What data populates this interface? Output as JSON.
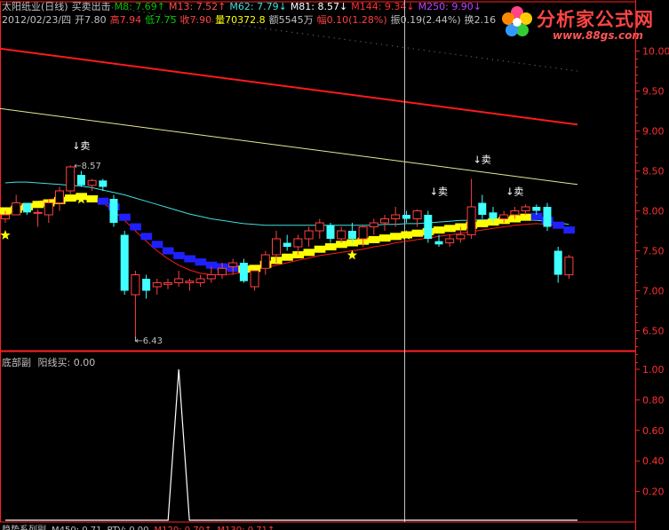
{
  "header": {
    "row1": [
      {
        "text": "太阳纸业(日线)",
        "color": "#c0c0c0"
      },
      {
        "text": "买卖出击",
        "color": "#c0c0c0"
      },
      {
        "text": "M8: 7.69↑",
        "color": "#00c000"
      },
      {
        "text": "M13: 7.52↑",
        "color": "#ff5050"
      },
      {
        "text": "M62: 7.79↓",
        "color": "#40e0e0"
      },
      {
        "text": "M81: 8.57↓",
        "color": "#ffffff"
      },
      {
        "text": "M144: 9.34↓",
        "color": "#ff3030"
      },
      {
        "text": "M250: 9.90↓",
        "color": "#c040ff"
      }
    ],
    "row2": [
      {
        "text": "2012/02/23/四",
        "color": "#c0c0c0"
      },
      {
        "text": "开7.80",
        "color": "#c0c0c0"
      },
      {
        "text": "高7.94",
        "color": "#ff4040"
      },
      {
        "text": "低7.75",
        "color": "#00d000"
      },
      {
        "text": "收7.90",
        "color": "#ff4040"
      },
      {
        "text": "量70372.8",
        "color": "#ffff00"
      },
      {
        "text": "额5545万",
        "color": "#c0c0c0"
      },
      {
        "text": "幅0.10(1.28%)",
        "color": "#ff4040"
      },
      {
        "text": "振0.19(2.44%)",
        "color": "#c0c0c0"
      },
      {
        "text": "换2.16",
        "color": "#c0c0c0"
      }
    ]
  },
  "watermark": {
    "main": "分析家公式网",
    "url": "www.88gs.com"
  },
  "colors": {
    "up": "#ff4040",
    "down": "#40ffff",
    "axis": "#ff2020",
    "ma_red": "#ff1a1a",
    "ma_yellow": "#e8e890",
    "ma_cyan": "#40e0e0",
    "band_yellow": "#ffff00",
    "band_blue": "#2020ff"
  },
  "price_axis": {
    "ticks": [
      "10.00",
      "9.50",
      "9.00",
      "8.50",
      "8.00",
      "7.50",
      "7.00",
      "6.50"
    ],
    "min": 6.25,
    "max": 10.25
  },
  "annotations": {
    "high_label": "8.57",
    "low_label": "6.43",
    "sell_label": "↓卖"
  },
  "sub_panel": {
    "title": "底部副",
    "indicator": "阳线买: 0.00",
    "ticks": [
      "1.00",
      "0.80",
      "0.60",
      "0.40",
      "0.20"
    ]
  },
  "footer": [
    {
      "text": "趋势系列副",
      "color": "#c0c0c0"
    },
    {
      "text": "M450: 0.71",
      "color": "#c0c0c0"
    },
    {
      "text": "PTV: 0.00",
      "color": "#c0c0c0"
    },
    {
      "text": "M120: 0.70↑",
      "color": "#ff4040"
    },
    {
      "text": "M130: 0.71↑",
      "color": "#ff4040"
    }
  ],
  "chart_data": {
    "type": "candlestick",
    "title": "太阳纸业(日线)",
    "ylim": [
      6.25,
      10.25
    ],
    "candles": [
      {
        "o": 7.9,
        "h": 8.0,
        "l": 7.85,
        "c": 7.95
      },
      {
        "o": 7.95,
        "h": 8.2,
        "l": 7.95,
        "c": 8.1
      },
      {
        "o": 8.1,
        "h": 8.1,
        "l": 7.95,
        "c": 7.98
      },
      {
        "o": 7.98,
        "h": 8.02,
        "l": 7.8,
        "c": 7.98
      },
      {
        "o": 7.95,
        "h": 8.15,
        "l": 7.85,
        "c": 8.1
      },
      {
        "o": 8.1,
        "h": 8.3,
        "l": 8.0,
        "c": 8.25
      },
      {
        "o": 8.25,
        "h": 8.57,
        "l": 8.2,
        "c": 8.55
      },
      {
        "o": 8.45,
        "h": 8.5,
        "l": 8.3,
        "c": 8.32
      },
      {
        "o": 8.32,
        "h": 8.4,
        "l": 8.25,
        "c": 8.38
      },
      {
        "o": 8.38,
        "h": 8.4,
        "l": 8.25,
        "c": 8.3
      },
      {
        "o": 8.15,
        "h": 8.2,
        "l": 7.8,
        "c": 7.85
      },
      {
        "o": 7.7,
        "h": 7.75,
        "l": 6.95,
        "c": 7.0
      },
      {
        "o": 6.95,
        "h": 7.25,
        "l": 6.43,
        "c": 7.2
      },
      {
        "o": 7.15,
        "h": 7.2,
        "l": 6.9,
        "c": 7.0
      },
      {
        "o": 7.05,
        "h": 7.15,
        "l": 6.95,
        "c": 7.1
      },
      {
        "o": 7.08,
        "h": 7.15,
        "l": 7.02,
        "c": 7.1
      },
      {
        "o": 7.1,
        "h": 7.25,
        "l": 7.05,
        "c": 7.15
      },
      {
        "o": 7.1,
        "h": 7.15,
        "l": 7.0,
        "c": 7.12
      },
      {
        "o": 7.1,
        "h": 7.2,
        "l": 7.05,
        "c": 7.15
      },
      {
        "o": 7.15,
        "h": 7.3,
        "l": 7.1,
        "c": 7.2
      },
      {
        "o": 7.2,
        "h": 7.35,
        "l": 7.15,
        "c": 7.28
      },
      {
        "o": 7.3,
        "h": 7.4,
        "l": 7.2,
        "c": 7.35
      },
      {
        "o": 7.35,
        "h": 7.4,
        "l": 7.1,
        "c": 7.12
      },
      {
        "o": 7.05,
        "h": 7.25,
        "l": 7.0,
        "c": 7.25
      },
      {
        "o": 7.28,
        "h": 7.5,
        "l": 7.2,
        "c": 7.45
      },
      {
        "o": 7.45,
        "h": 7.75,
        "l": 7.35,
        "c": 7.65
      },
      {
        "o": 7.6,
        "h": 7.7,
        "l": 7.5,
        "c": 7.55
      },
      {
        "o": 7.55,
        "h": 7.7,
        "l": 7.45,
        "c": 7.65
      },
      {
        "o": 7.65,
        "h": 7.8,
        "l": 7.55,
        "c": 7.75
      },
      {
        "o": 7.75,
        "h": 7.9,
        "l": 7.65,
        "c": 7.85
      },
      {
        "o": 7.82,
        "h": 7.85,
        "l": 7.6,
        "c": 7.65
      },
      {
        "o": 7.65,
        "h": 7.8,
        "l": 7.6,
        "c": 7.75
      },
      {
        "o": 7.75,
        "h": 7.85,
        "l": 7.6,
        "c": 7.65
      },
      {
        "o": 7.65,
        "h": 7.82,
        "l": 7.55,
        "c": 7.8
      },
      {
        "o": 7.8,
        "h": 7.9,
        "l": 7.7,
        "c": 7.85
      },
      {
        "o": 7.85,
        "h": 7.95,
        "l": 7.75,
        "c": 7.9
      },
      {
        "o": 7.9,
        "h": 8.05,
        "l": 7.8,
        "c": 7.95
      },
      {
        "o": 7.95,
        "h": 8.0,
        "l": 7.85,
        "c": 7.9
      },
      {
        "o": 7.9,
        "h": 8.02,
        "l": 7.8,
        "c": 8.0
      },
      {
        "o": 7.95,
        "h": 8.0,
        "l": 7.6,
        "c": 7.65
      },
      {
        "o": 7.62,
        "h": 7.7,
        "l": 7.55,
        "c": 7.58
      },
      {
        "o": 7.6,
        "h": 7.7,
        "l": 7.55,
        "c": 7.65
      },
      {
        "o": 7.65,
        "h": 7.8,
        "l": 7.6,
        "c": 7.7
      },
      {
        "o": 7.7,
        "h": 8.4,
        "l": 7.65,
        "c": 8.05
      },
      {
        "o": 8.1,
        "h": 8.2,
        "l": 7.9,
        "c": 7.95
      },
      {
        "o": 7.98,
        "h": 8.05,
        "l": 7.85,
        "c": 7.9
      },
      {
        "o": 7.9,
        "h": 8.0,
        "l": 7.85,
        "c": 7.95
      },
      {
        "o": 7.95,
        "h": 8.05,
        "l": 7.9,
        "c": 8.0
      },
      {
        "o": 8.0,
        "h": 8.08,
        "l": 7.95,
        "c": 8.05
      },
      {
        "o": 8.05,
        "h": 8.08,
        "l": 7.95,
        "c": 8.0
      },
      {
        "o": 8.05,
        "h": 8.1,
        "l": 7.75,
        "c": 7.8
      },
      {
        "o": 7.5,
        "h": 7.55,
        "l": 7.1,
        "c": 7.2
      },
      {
        "o": 7.2,
        "h": 7.45,
        "l": 7.15,
        "c": 7.42
      }
    ],
    "ma_red": [
      8.02,
      8.05,
      8.08,
      8.12,
      8.14,
      8.16,
      8.18,
      8.17,
      8.15,
      8.1,
      8.0,
      7.88,
      7.75,
      7.62,
      7.5,
      7.4,
      7.32,
      7.26,
      7.22,
      7.2,
      7.2,
      7.21,
      7.23,
      7.26,
      7.29,
      7.32,
      7.35,
      7.38,
      7.41,
      7.44,
      7.46,
      7.48,
      7.5,
      7.52,
      7.55,
      7.57,
      7.6,
      7.62,
      7.64,
      7.66,
      7.68,
      7.7,
      7.72,
      7.74,
      7.76,
      7.78,
      7.8,
      7.82,
      7.83,
      7.84,
      7.83,
      7.81,
      7.78
    ],
    "ma_cyan": [
      8.35,
      8.36,
      8.36,
      8.35,
      8.34,
      8.33,
      8.32,
      8.31,
      8.29,
      8.26,
      8.23,
      8.2,
      8.16,
      8.12,
      8.08,
      8.04,
      8.0,
      7.96,
      7.93,
      7.9,
      7.88,
      7.86,
      7.84,
      7.83,
      7.82,
      7.82,
      7.82,
      7.82,
      7.82,
      7.82,
      7.82,
      7.82,
      7.82,
      7.82,
      7.82,
      7.83,
      7.83,
      7.84,
      7.84,
      7.85,
      7.86,
      7.87,
      7.88,
      7.88,
      7.89,
      7.89,
      7.89,
      7.89,
      7.89,
      7.88,
      7.87,
      7.85,
      7.83
    ],
    "ma_yellow_long": {
      "start": 9.28,
      "end": 8.33
    },
    "ma_red_long": {
      "start": 10.03,
      "end": 9.08
    },
    "band": [
      {
        "v": 8.0,
        "d": "up"
      },
      {
        "v": 8.02,
        "d": "up"
      },
      {
        "v": 8.05,
        "d": "up"
      },
      {
        "v": 8.08,
        "d": "up"
      },
      {
        "v": 8.1,
        "d": "up"
      },
      {
        "v": 8.13,
        "d": "up"
      },
      {
        "v": 8.16,
        "d": "up"
      },
      {
        "v": 8.18,
        "d": "up"
      },
      {
        "v": 8.15,
        "d": "up"
      },
      {
        "v": 8.12,
        "d": "down"
      },
      {
        "v": 8.05,
        "d": "down"
      },
      {
        "v": 7.92,
        "d": "down"
      },
      {
        "v": 7.8,
        "d": "down"
      },
      {
        "v": 7.68,
        "d": "down"
      },
      {
        "v": 7.58,
        "d": "down"
      },
      {
        "v": 7.5,
        "d": "down"
      },
      {
        "v": 7.44,
        "d": "down"
      },
      {
        "v": 7.4,
        "d": "down"
      },
      {
        "v": 7.36,
        "d": "down"
      },
      {
        "v": 7.32,
        "d": "down"
      },
      {
        "v": 7.3,
        "d": "down"
      },
      {
        "v": 7.28,
        "d": "down"
      },
      {
        "v": 7.27,
        "d": "up"
      },
      {
        "v": 7.28,
        "d": "up"
      },
      {
        "v": 7.33,
        "d": "up"
      },
      {
        "v": 7.38,
        "d": "up"
      },
      {
        "v": 7.42,
        "d": "up"
      },
      {
        "v": 7.45,
        "d": "up"
      },
      {
        "v": 7.48,
        "d": "up"
      },
      {
        "v": 7.52,
        "d": "up"
      },
      {
        "v": 7.55,
        "d": "up"
      },
      {
        "v": 7.58,
        "d": "up"
      },
      {
        "v": 7.6,
        "d": "up"
      },
      {
        "v": 7.62,
        "d": "up"
      },
      {
        "v": 7.64,
        "d": "up"
      },
      {
        "v": 7.66,
        "d": "up"
      },
      {
        "v": 7.68,
        "d": "up"
      },
      {
        "v": 7.7,
        "d": "up"
      },
      {
        "v": 7.72,
        "d": "up"
      },
      {
        "v": 7.74,
        "d": "up"
      },
      {
        "v": 7.76,
        "d": "up"
      },
      {
        "v": 7.78,
        "d": "up"
      },
      {
        "v": 7.8,
        "d": "up"
      },
      {
        "v": 7.82,
        "d": "up"
      },
      {
        "v": 7.84,
        "d": "up"
      },
      {
        "v": 7.86,
        "d": "up"
      },
      {
        "v": 7.88,
        "d": "up"
      },
      {
        "v": 7.9,
        "d": "up"
      },
      {
        "v": 7.92,
        "d": "up"
      },
      {
        "v": 7.93,
        "d": "down"
      },
      {
        "v": 7.88,
        "d": "down"
      },
      {
        "v": 7.82,
        "d": "down"
      },
      {
        "v": 7.76,
        "d": "down"
      }
    ],
    "stars": [
      0,
      7,
      32,
      37,
      59
    ],
    "sell_marks": [
      11,
      56,
      62,
      64
    ],
    "sub_series": {
      "peak_index": 16,
      "peak_value": 1.0
    }
  }
}
